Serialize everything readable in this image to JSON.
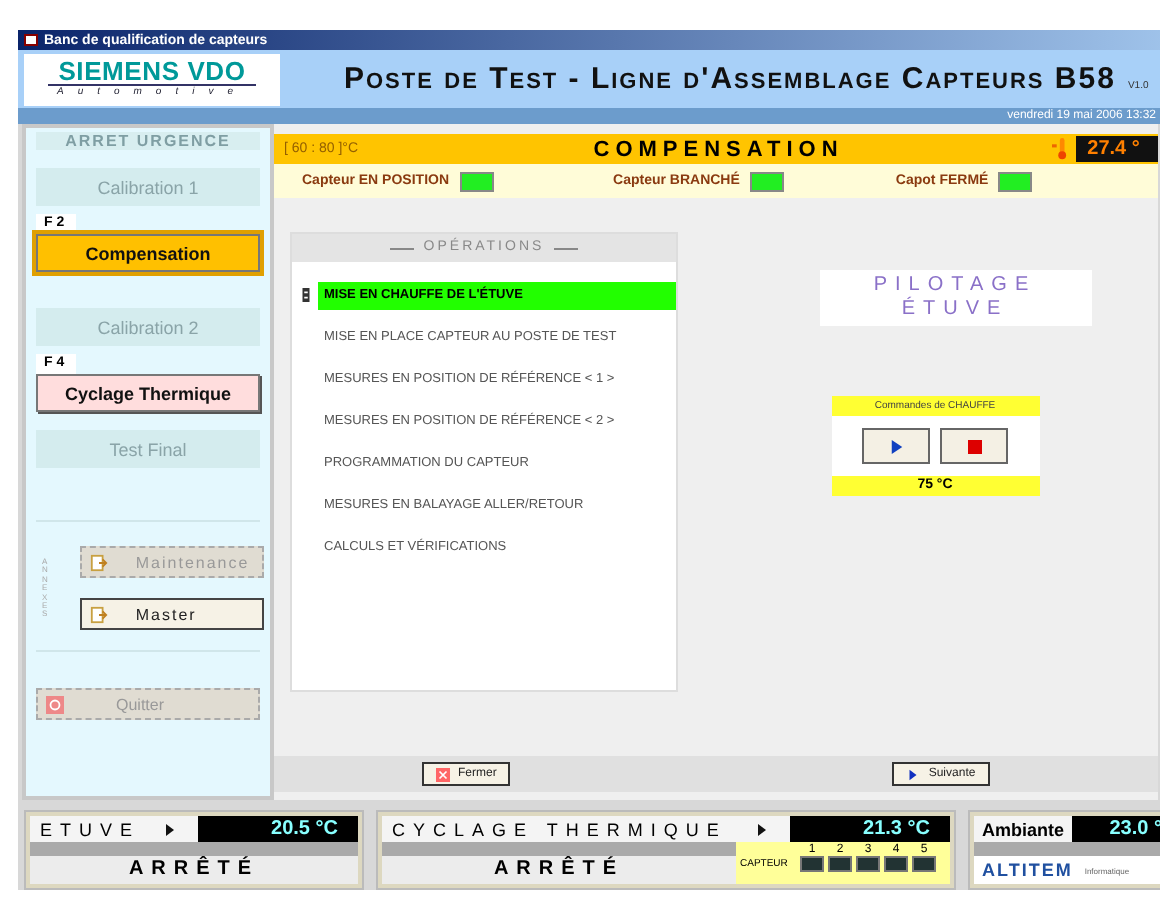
{
  "window": {
    "title": "Banc de qualification de capteurs"
  },
  "header": {
    "logo_brand": "SIEMENS VDO",
    "logo_sub": "Automotive",
    "title": "Poste de Test - Ligne d'Assemblage Capteurs B58",
    "version": "V1.0",
    "date": "vendredi 19 mai 2006  13:32"
  },
  "sidebar": {
    "emergency": "ARRET URGENCE",
    "steps": [
      {
        "label": "Calibration 1",
        "kind": "disabled",
        "selected": false
      },
      {
        "label": "Compensation",
        "key": "F 2",
        "kind": "active",
        "selected": true
      },
      {
        "label": "Calibration 2",
        "kind": "disabled",
        "selected": false
      },
      {
        "label": "Cyclage Thermique",
        "key": "F 4",
        "kind": "active",
        "selected": false
      },
      {
        "label": "Test Final",
        "kind": "disabled",
        "selected": false
      }
    ],
    "annexes_label": "ANNEXES",
    "annexes": [
      {
        "label": "Maintenance",
        "disabled": true
      },
      {
        "label": "Master",
        "disabled": false
      }
    ],
    "quit": {
      "label": "Quitter",
      "disabled": true
    }
  },
  "stage": {
    "range": "[ 60 : 80 ]°C",
    "title": "COMPENSATION",
    "temperature": "27.4 °"
  },
  "indicators": [
    {
      "label": "Capteur EN POSITION",
      "on": true
    },
    {
      "label": "Capteur BRANCHÉ",
      "on": true
    },
    {
      "label": "Capot FERMÉ",
      "on": true
    }
  ],
  "operations": {
    "title": "OPÉRATIONS",
    "items": [
      {
        "label": "MISE EN CHAUFFE DE L'ÉTUVE",
        "selected": true
      },
      {
        "label": "MISE EN PLACE CAPTEUR AU POSTE DE TEST",
        "selected": false
      },
      {
        "label": "MESURES EN POSITION DE RÉFÉRENCE  < 1 >",
        "selected": false
      },
      {
        "label": "MESURES EN POSITION DE RÉFÉRENCE  < 2 >",
        "selected": false
      },
      {
        "label": "PROGRAMMATION DU CAPTEUR",
        "selected": false
      },
      {
        "label": "MESURES EN BALAYAGE ALLER/RETOUR",
        "selected": false
      },
      {
        "label": "CALCULS ET VÉRIFICATIONS",
        "selected": false
      }
    ]
  },
  "pilotage": {
    "line1": "PILOTAGE",
    "line2": "ÉTUVE",
    "commands_title": "Commandes de CHAUFFE",
    "setpoint": "75 °C"
  },
  "nav": {
    "close": "Fermer",
    "next": "Suivante"
  },
  "status": {
    "etuve": {
      "label": "ETUVE",
      "temperature": "20.5 °C",
      "state": "ARRÊTÉ"
    },
    "cyclage": {
      "label": "CYCLAGE THERMIQUE",
      "temperature": "21.3 °C",
      "state": "ARRÊTÉ",
      "sensor_label": "CAPTEUR",
      "sensors": [
        {
          "number": "1",
          "on": false
        },
        {
          "number": "2",
          "on": false
        },
        {
          "number": "3",
          "on": false
        },
        {
          "number": "4",
          "on": false
        },
        {
          "number": "5",
          "on": false
        }
      ]
    },
    "ambient": {
      "label": "Ambiante",
      "temperature": "23.0 °",
      "logo": "ALTITEM",
      "logo_note": "Informatique"
    }
  }
}
